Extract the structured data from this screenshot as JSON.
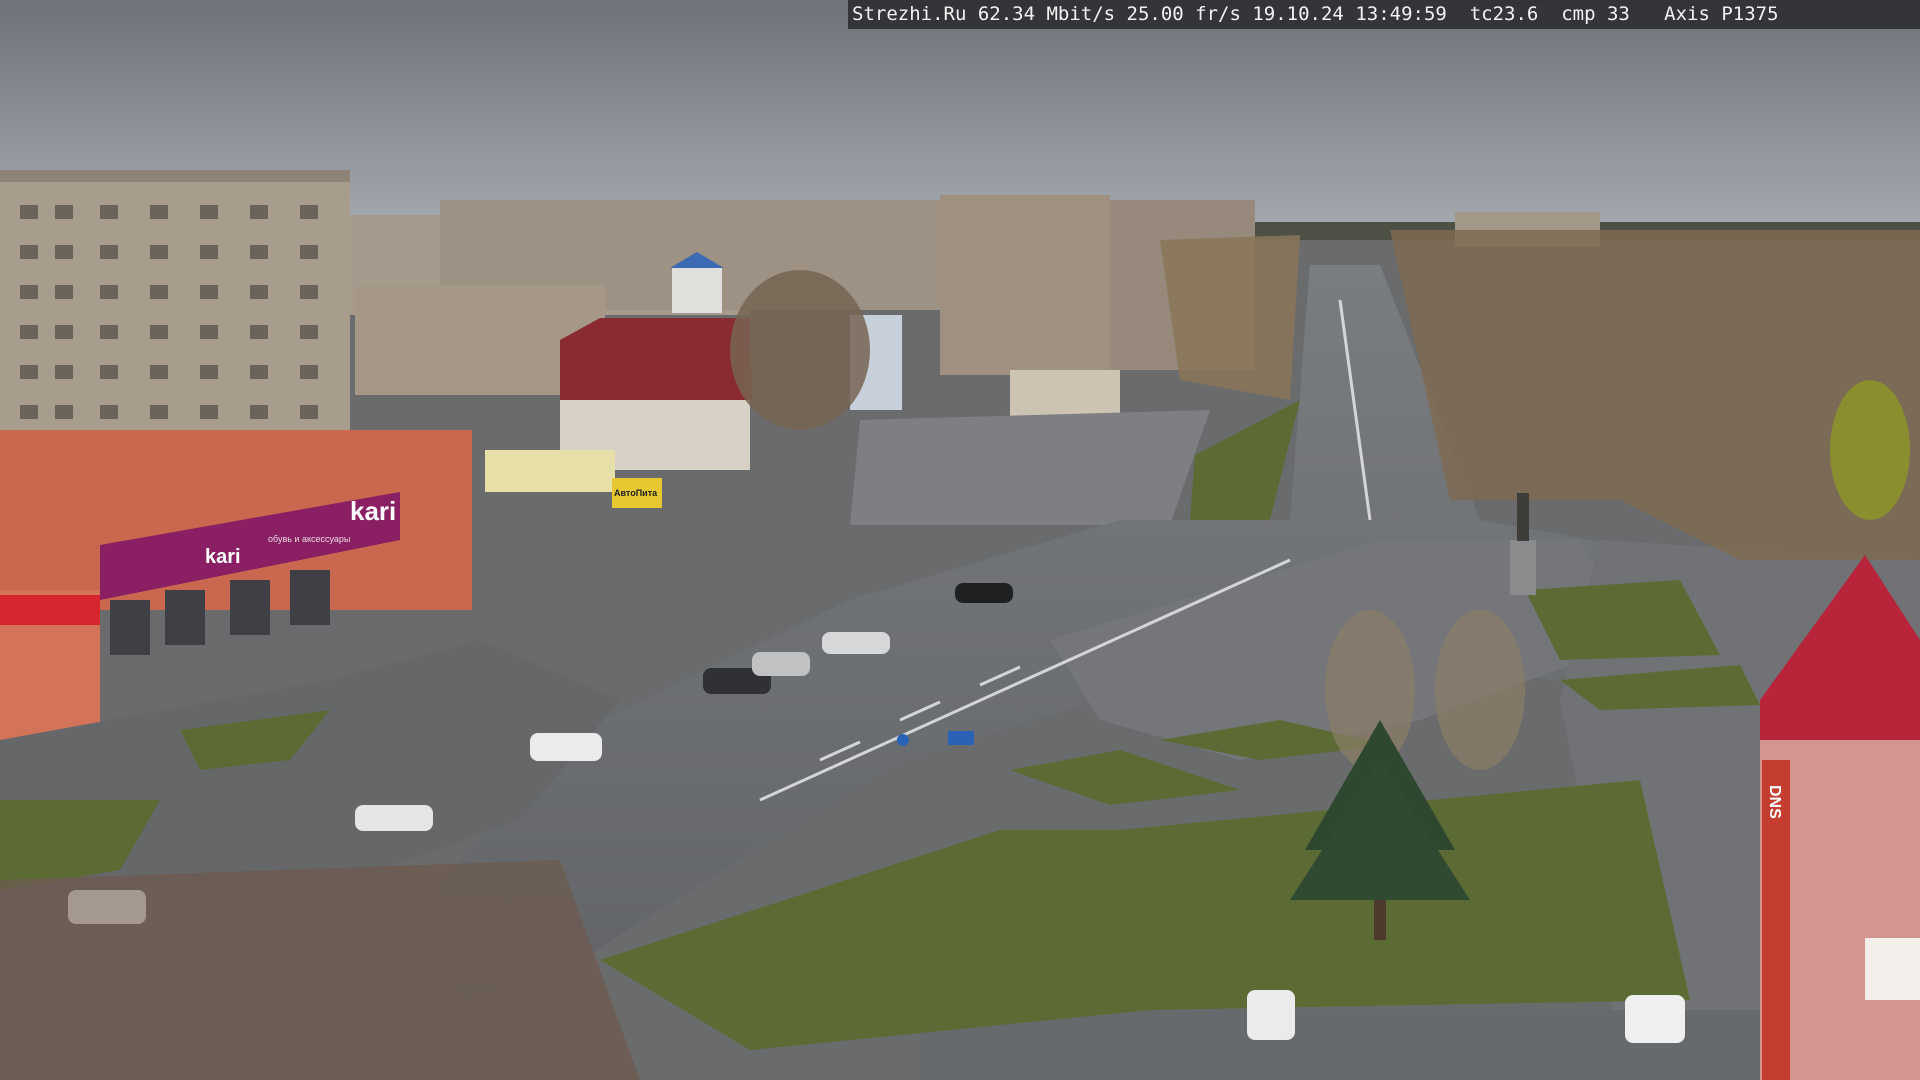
{
  "camera_overlay": {
    "text": "Strezhi.Ru 62.34 Mbit/s 25.00 fr/s 19.10.24 13:49:59  tc23.6  cmp 33   Axis P1375"
  },
  "signs": {
    "store_main": "kari",
    "store_small": "kari",
    "store_sub": "обувь и аксессуары",
    "kiosk": "АвтоПита",
    "right_building_vertical": "DNS"
  },
  "colors": {
    "sky": "#9aa0a6",
    "asphalt": "#6e7073",
    "grass": "#5b6b33",
    "brick_orange": "#c9684e",
    "kari_magenta": "#8a1f63",
    "roof_red": "#b8243a"
  }
}
